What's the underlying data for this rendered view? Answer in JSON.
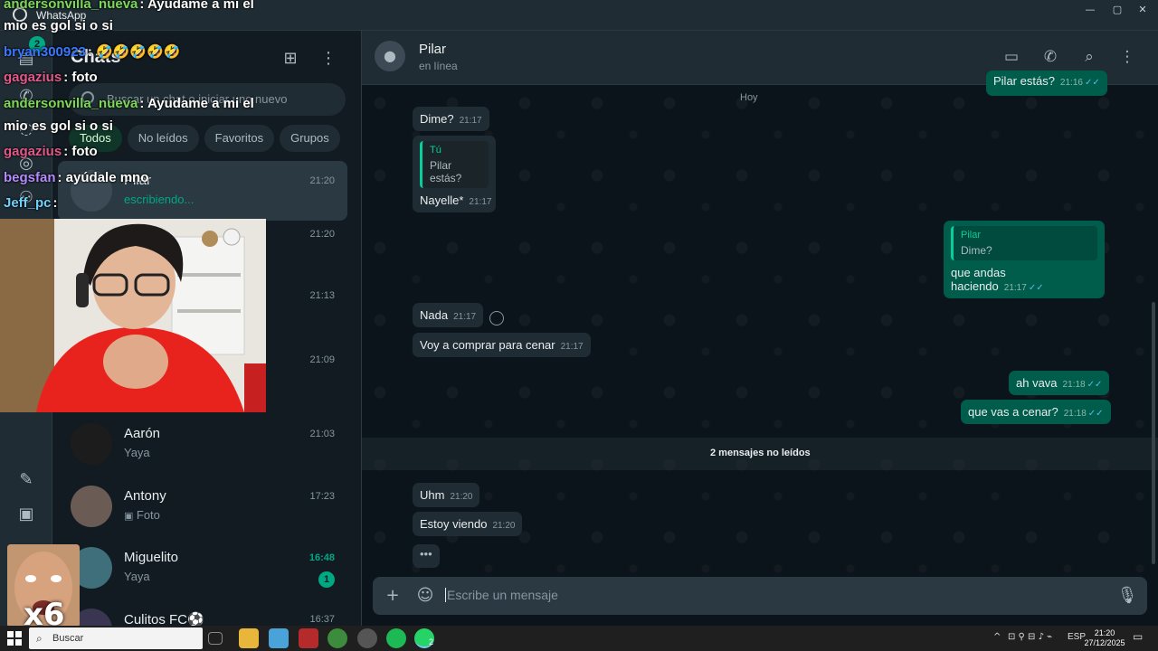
{
  "window": {
    "title": "WhatsApp",
    "controls": {
      "minimize": "—",
      "maximize": "▢",
      "close": "✕"
    }
  },
  "rail": {
    "chats_badge": "2",
    "icons": [
      "chats-icon",
      "calls-icon",
      "status-icon",
      "channels-icon",
      "communities-icon",
      "meta-ai-icon",
      "media-icon"
    ]
  },
  "chat_list": {
    "title": "Chats",
    "new_chat_icon": "new-chat-icon",
    "menu_icon": "kebab-menu-icon",
    "search": {
      "placeholder": "Buscar un chat o iniciar uno nuevo"
    },
    "filters": [
      {
        "label": "Todos",
        "active": true
      },
      {
        "label": "No leídos",
        "active": false
      },
      {
        "label": "Favoritos",
        "active": false
      },
      {
        "label": "Grupos",
        "active": false
      }
    ],
    "items": [
      {
        "name": "Pilar",
        "preview": "escribiendo...",
        "time": "21:20",
        "typing": true,
        "selected": true
      },
      {
        "name": "",
        "preview": "",
        "time": "21:20"
      },
      {
        "name": "",
        "preview": "",
        "time": "21:13"
      },
      {
        "name": "",
        "preview": "",
        "time": "21:09"
      },
      {
        "name": "Aarón",
        "preview": "Yaya",
        "time": "21:03"
      },
      {
        "name": "Antony",
        "preview": "Foto",
        "time": "17:23",
        "preview_icon": "photo-icon"
      },
      {
        "name": "Miguelito",
        "preview": "Yaya",
        "time": "16:48",
        "unread_count": "1"
      },
      {
        "name": "Culitos FC⚽",
        "preview": "",
        "time": "16:37"
      }
    ]
  },
  "chat": {
    "contact_name": "Pilar",
    "status": "en línea",
    "header_icons": [
      "video-call-icon",
      "voice-call-icon",
      "search-icon",
      "kebab-menu-icon"
    ],
    "top_partial": {
      "text": "Pilar estás?",
      "time": "21:16"
    },
    "date_label": "Hoy",
    "messages": [
      {
        "dir": "in",
        "text": "Dime?",
        "time": "21:17"
      },
      {
        "dir": "in",
        "quote_author": "Tú",
        "quote_text": "Pilar estás?",
        "text": "Nayelle*",
        "time": "21:17"
      },
      {
        "dir": "out",
        "quote_author": "Pilar",
        "quote_text": "Dime?",
        "text": "que andas haciendo",
        "time": "21:17"
      },
      {
        "dir": "in",
        "text": "Nada",
        "time": "21:17"
      },
      {
        "dir": "in",
        "text": "Voy a comprar para cenar",
        "time": "21:17"
      },
      {
        "dir": "out",
        "text": "ah vava",
        "time": "21:18"
      },
      {
        "dir": "out",
        "text": "que vas a cenar?",
        "time": "21:18"
      },
      {
        "dir": "in",
        "text": "Uhm",
        "time": "21:20"
      },
      {
        "dir": "in",
        "text": "Estoy viendo",
        "time": "21:20"
      }
    ],
    "unread_banner": "2 mensajes no leídos",
    "typing_dots": "•••",
    "composer": {
      "placeholder": "Escribe un mensaje",
      "plus_icon": "+",
      "sticker_icon": "sticker-icon",
      "mic_icon": "mic-icon"
    }
  },
  "stream_overlay": {
    "chat_lines": [
      {
        "user": "andersonvilla_nueva",
        "color": "#7ed957",
        "msg": ": Ayudame a mi el"
      },
      {
        "user": "",
        "color": "#ffffff",
        "msg": "mio es gol si o si"
      },
      {
        "user": "bryan300923",
        "color": "#3a78ff",
        "msg": ": 🤣🤣🤣🤣🤣"
      },
      {
        "user": "gagazius",
        "color": "#e05a8a",
        "msg": ": foto"
      },
      {
        "user": "andersonvilla_nueva",
        "color": "#7ed957",
        "msg": ": Ayudame a mi el"
      },
      {
        "user": "",
        "color": "#ffffff",
        "msg": "mio es gol si o si"
      },
      {
        "user": "gagazius",
        "color": "#e05a8a",
        "msg": ": foto"
      },
      {
        "user": "begsfan",
        "color": "#b48cff",
        "msg": ": ayúdale mno"
      },
      {
        "user": "Jeff_pc",
        "color": "#6fd3ff",
        "msg": ":"
      }
    ],
    "multiplier": "x6"
  },
  "taskbar": {
    "search_label": "Buscar",
    "whatsapp_badge": "2",
    "lang": "ESP",
    "time": "21:20",
    "date": "27/12/2025"
  }
}
